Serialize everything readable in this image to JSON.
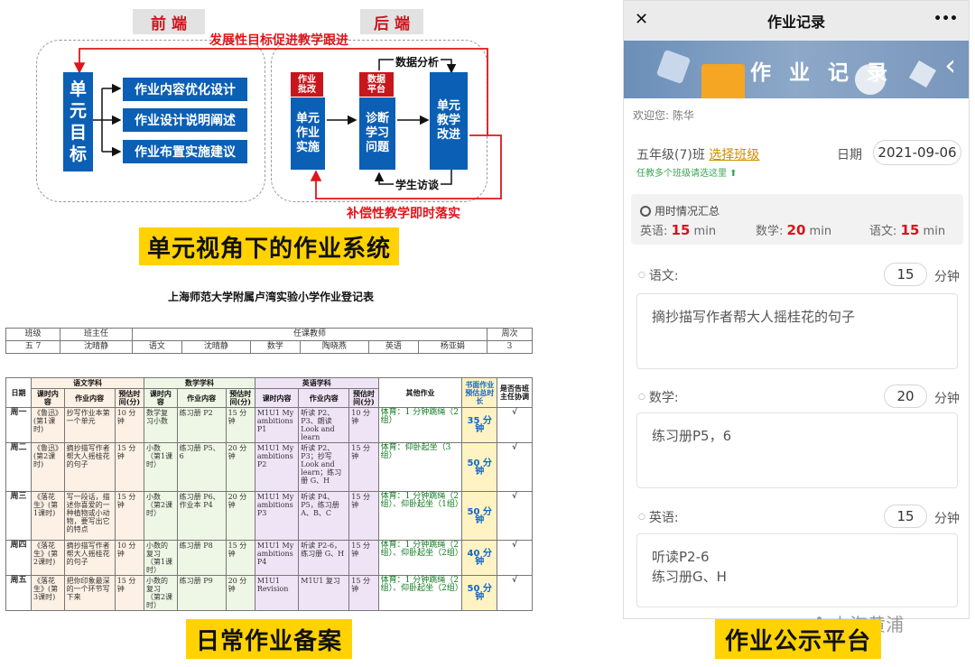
{
  "diagram": {
    "front_label": "前 端",
    "back_label": "后 端",
    "top_arrow_text": "发展性目标促进教学跟进",
    "unit_goal": [
      "单",
      "元",
      "目",
      "标"
    ],
    "front_items": [
      "作业内容优化设计",
      "作业设计说明阐述",
      "作业布置实施建议"
    ],
    "tag_homework": [
      "作业",
      "批改"
    ],
    "tag_data": [
      "数据",
      "平台"
    ],
    "box_impl": [
      "单元",
      "作业",
      "实施"
    ],
    "box_diag": [
      "诊断",
      "学习",
      "问题"
    ],
    "box_improve": [
      "单元",
      "教学",
      "改进"
    ],
    "data_analysis": "数据分析",
    "student_interview": "学生访谈",
    "bottom_arrow_text": "补偿性教学即时落实",
    "title": "单元视角下的作业系统"
  },
  "table": {
    "title": "上海师范大学附属卢湾实验小学作业登记表",
    "header1": {
      "class_label": "班级",
      "headteacher_label": "班主任",
      "teacher_label": "任课教师",
      "week_label": "周次",
      "class_value": "五 7",
      "headteacher_value": "沈晴静",
      "chinese": "语文",
      "chinese_teacher": "沈晴静",
      "math": "数学",
      "math_teacher": "陶晓燕",
      "english": "英语",
      "english_teacher": "杨亚娟",
      "week_value": "3"
    },
    "cols": {
      "date": "日期",
      "chinese_subject": "语文学科",
      "math_subject": "数学学科",
      "english_subject": "英语学科",
      "content": "课时内容",
      "homework": "作业内容",
      "time": "预估时间(分)",
      "other": "其他作业",
      "total": "书面作业预估总时长",
      "sign": "是否告班主任协调"
    },
    "rows": [
      {
        "day": "周一",
        "c_content": "《鲁迅》(第1课时)",
        "c_hw": "抄写作业本第一个单元",
        "c_time": "10 分钟",
        "m_content": "数学复习小数",
        "m_hw": "练习册 P2",
        "m_time": "15 分钟",
        "e_content": "M1U1 My ambitions P1",
        "e_hw": "听读 P2、P3、朗读 Look and learn",
        "e_time": "10 分钟",
        "other": "体育：1 分钟跳绳（2组）",
        "total": "35 分钟",
        "sign": "√"
      },
      {
        "day": "周二",
        "c_content": "《鲁迅》(第2课时)",
        "c_hw": "摘抄描写作者帮大人摇桂花的句子",
        "c_time": "15 分钟",
        "m_content": "小数（第1课时）",
        "m_hw": "练习册 P5、6",
        "m_time": "20 分钟",
        "e_content": "M1U1 My ambitions P2",
        "e_hw": "听读 P2、P3；抄写 Look and learn；练习册 G、H",
        "e_time": "15 分钟",
        "other": "体育：仰卧起坐（3组）",
        "total": "50 分钟",
        "sign": "√"
      },
      {
        "day": "周三",
        "c_content": "《落花生》(第1课时)",
        "c_hw": "写一段话，描述你喜爱的一种植物或小动物，要写出它的特点",
        "c_time": "15 分钟",
        "m_content": "小数（第2课时）",
        "m_hw": "练习册 P6、作业本 P4",
        "m_time": "20 分钟",
        "e_content": "M1U1 My ambitions P3",
        "e_hw": "听读 P4、P5，练习册 A、B、C",
        "e_time": "15 分钟",
        "other": "体育：1 分钟跳绳（2组）、仰卧起坐（1组）",
        "total": "50 分钟",
        "sign": "√"
      },
      {
        "day": "周四",
        "c_content": "《落花生》(第2课时)",
        "c_hw": "摘抄描写作者帮大人摇桂花的句子",
        "c_time": "10 分钟",
        "m_content": "小数的复习（第1课时）",
        "m_hw": "练习册 P8",
        "m_time": "15 分钟",
        "e_content": "M1U1 My ambitions P4",
        "e_hw": "听读 P2-6，练习册 G、H",
        "e_time": "15 分钟",
        "other": "体育：1 分钟跳绳（2组）、仰卧起坐（2组）",
        "total": "40 分钟",
        "sign": "√"
      },
      {
        "day": "周五",
        "c_content": "《落花生》(第3课时)",
        "c_hw": "把你印象最深的一个环节写下来",
        "c_time": "15 分钟",
        "m_content": "小数的复习（第2课时）",
        "m_hw": "练习册 P9",
        "m_time": "20 分钟",
        "e_content": "M1U1 Revision",
        "e_hw": "M1U1 复习",
        "e_time": "15 分钟",
        "other": "体育：1 分钟跳绳（2组）、仰卧起坐（2组）",
        "total": "50 分钟",
        "sign": "√"
      }
    ],
    "footer_title": "日常作业备案"
  },
  "phone": {
    "close": "✕",
    "title": "作业记录",
    "more": "•••",
    "banner_title": "作 业 记 录",
    "back": "‹",
    "welcome": "欢迎您: 陈华",
    "class_text": "五年级(7)班",
    "select_class": "选择班级",
    "multi_class_tip": "任教多个班级请选这里 ⬆",
    "date_label": "日期",
    "date_value": "2021-09-06",
    "summary_title": "用时情况汇总",
    "summary": [
      {
        "label": "英语:",
        "value": "15",
        "unit": "min"
      },
      {
        "label": "数学:",
        "value": "20",
        "unit": "min"
      },
      {
        "label": "语文:",
        "value": "15",
        "unit": "min"
      }
    ],
    "subjects": [
      {
        "label": "语文:",
        "minutes": "15",
        "unit": "分钟",
        "text": "摘抄描写作者帮大人摇桂花的句子"
      },
      {
        "label": "数学:",
        "minutes": "20",
        "unit": "分钟",
        "text": "练习册P5，6"
      },
      {
        "label": "英语:",
        "minutes": "15",
        "unit": "分钟",
        "text": "听读P2-6\n练习册G、H"
      }
    ],
    "watermark": "上海黄浦",
    "footer_title": "作业公示平台"
  },
  "colors": {
    "blue": "#0b5fb4",
    "red": "#e0151b",
    "yellow": "#ffd200"
  }
}
